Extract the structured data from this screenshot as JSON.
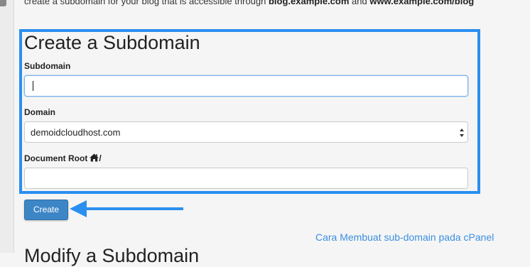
{
  "intro": {
    "text_before": "create a subdomain for your blog that is accessible through ",
    "bold_1": "blog.example.com",
    "text_between": " and ",
    "bold_2": "www.example.com/blog"
  },
  "form": {
    "title": "Create a Subdomain",
    "subdomain": {
      "label": "Subdomain",
      "value": ""
    },
    "domain": {
      "label": "Domain",
      "selected": "demoidcloudhost.com"
    },
    "document_root": {
      "label": "Document Root",
      "suffix": "/",
      "value": ""
    },
    "create_label": "Create"
  },
  "caption": "Cara Membuat sub-domain pada cPanel",
  "next_section_title": "Modify a Subdomain",
  "colors": {
    "highlight": "#2a8ff0",
    "button": "#3d86c6",
    "caption": "#3b8fe0"
  },
  "icons": {
    "home": "home-icon",
    "select_arrows": "select-arrows-icon",
    "pointer_arrow": "left-arrow-icon"
  }
}
